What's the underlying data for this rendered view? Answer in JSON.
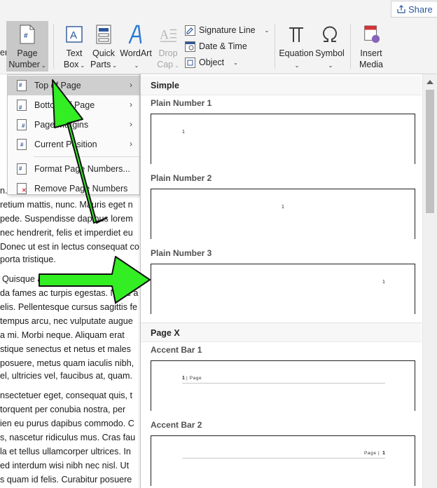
{
  "share": {
    "label": "Share",
    "icon": "share-icon"
  },
  "ribbon": {
    "page_number": {
      "line1": "Page",
      "line2": "Number"
    },
    "partial_left_label": "er",
    "text_box": {
      "line1": "Text",
      "line2": "Box"
    },
    "quick_parts": {
      "line1": "Quick",
      "line2": "Parts"
    },
    "wordart": {
      "line1": "WordArt"
    },
    "drop_cap": {
      "line1": "Drop",
      "line2": "Cap"
    },
    "signature_line": "Signature Line",
    "date_time": "Date & Time",
    "object": "Object",
    "equation": {
      "line1": "Equation"
    },
    "symbol": {
      "line1": "Symbol"
    },
    "insert_media": {
      "line1": "Insert",
      "line2": "Media"
    }
  },
  "menu": {
    "items": [
      {
        "label": "Top of Page",
        "icon": "page-top-icon",
        "submenu": true,
        "active": true
      },
      {
        "label": "Bottom of Page",
        "icon": "page-bottom-icon",
        "submenu": true,
        "active": false
      },
      {
        "label": "Page Margins",
        "icon": "page-margins-icon",
        "submenu": true,
        "active": false
      },
      {
        "label": "Current Position",
        "icon": "current-position-icon",
        "submenu": true,
        "active": false
      }
    ],
    "format": {
      "label": "Format Page Numbers...",
      "icon": "format-page-numbers-icon"
    },
    "remove": {
      "label": "Remove Page Numbers",
      "icon": "remove-page-numbers-icon"
    }
  },
  "gallery": {
    "categories": [
      {
        "name": "Simple"
      },
      {
        "name": "Page X"
      }
    ],
    "items": [
      {
        "title": "Plain Number 1",
        "number": "1",
        "align": "left"
      },
      {
        "title": "Plain Number 2",
        "number": "1",
        "align": "center"
      },
      {
        "title": "Plain Number 3",
        "number": "1",
        "align": "right"
      },
      {
        "title": "Accent Bar 1",
        "number": "1",
        "accent": "| Page"
      },
      {
        "title": "Accent Bar 2",
        "number": "1",
        "accent": "Page |"
      }
    ]
  },
  "document": {
    "lines": [
      "n.",
      "retium mattis, nunc. Mauris eget n",
      "pede. Suspendisse dapibus lorem",
      "nec hendrerit, felis et imperdiet eu",
      "Donec ut est in lectus consequat co",
      "porta tristique.",
      "Quisque a",
      "da fames ac turpis egestas. Nunc a",
      "elis. Pellentesque cursus sagittis fe",
      "tempus arcu, nec vulputate augue",
      "a mi. Morbi neque. Aliquam erat",
      "stique senectus et netus et males",
      "posuere, metus quam iaculis nibh,",
      "el, ultricies vel, faucibus at, quam.",
      "nsectetuer eget, consequat quis, t",
      "torquent per conubia nostra, per",
      "ien eu purus dapibus commodo. C",
      "s, nascetur ridiculus mus. Cras fau",
      "la et tellus ullamcorper ultrices. In",
      "ed interdum wisi nibh nec nisl. Ut",
      "s quam id felis. Curabitur posuere"
    ]
  },
  "colors": {
    "highlight_arrow": "#33ee22",
    "ribbon_bg": "#f3f3f3",
    "menu_active": "#cfcfcf",
    "accent_blue": "#2b579a"
  }
}
